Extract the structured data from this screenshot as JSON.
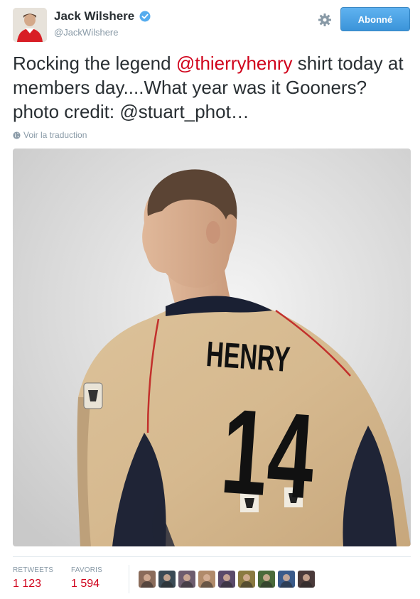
{
  "header": {
    "display_name": "Jack Wilshere",
    "handle": "@JackWilshere",
    "follow_label": "Abonné",
    "verified_icon": "verified-badge-icon",
    "settings_icon": "gear-icon"
  },
  "tweet": {
    "text_before": "Rocking the legend ",
    "mention": "@thierryhenry",
    "text_after": " shirt today at members day....What year was it Gooners? photo credit: @stuart_phot…",
    "translate_label": "Voir la traduction",
    "translate_icon": "globe-icon"
  },
  "photo": {
    "shirt_name": "HENRY",
    "shirt_number": "14"
  },
  "stats": {
    "retweets_label": "RETWEETS",
    "retweets_value": "1 123",
    "favorites_label": "FAVORIS",
    "favorites_value": "1 594"
  },
  "favoriters": [
    "#8a6b5a",
    "#3a4a55",
    "#6d5c6e",
    "#b08a6a",
    "#5a4a6a",
    "#8a7a40",
    "#4a6a3a",
    "#3a5a8a",
    "#4a3a3a"
  ],
  "colors": {
    "accent": "#d0021b",
    "follow_button": "#4ba3e8",
    "muted_text": "#8899a6",
    "verified": "#55acee"
  }
}
